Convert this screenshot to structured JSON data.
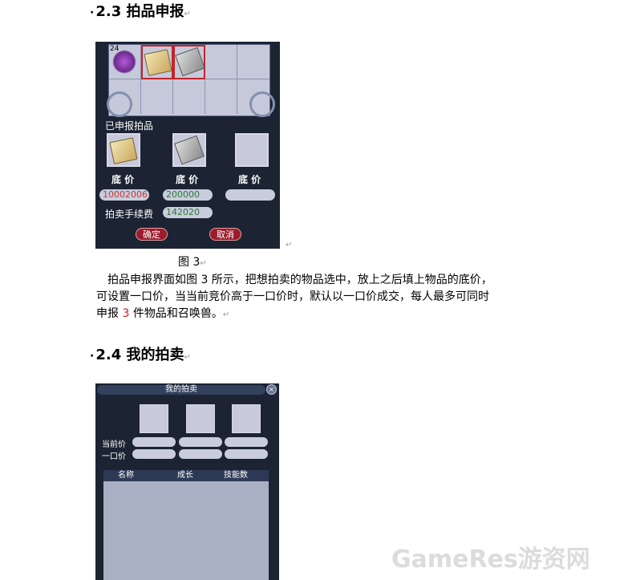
{
  "section1": {
    "bullet": "·",
    "title": "2.3 拍品申报",
    "mark": "↵"
  },
  "panel1": {
    "slot_count": "24",
    "reported_label": "已申报拍品",
    "floor_label": "底 价",
    "prices": [
      "10002006",
      "200000",
      ""
    ],
    "fee_label": "拍卖手续费",
    "fee_value": "142020",
    "ok": "确定",
    "cancel": "取消"
  },
  "figure_mark": "↵",
  "caption": {
    "text": "图 3",
    "mark": "↵"
  },
  "paragraph": {
    "line1": "拍品申报界面如图 3 所示，把想拍卖的物品选中，放上之后填上物品的底价，",
    "line2": "可设置一口价，当当前竞价高于一口价时，默认以一口价成交，每人最多可同时",
    "line3_before": "申报 ",
    "line3_red": "3",
    "line3_after": " 件物品和召唤兽。",
    "mark": "↵"
  },
  "section2": {
    "bullet": "·",
    "title": "2.4 我的拍卖",
    "mark": "↵"
  },
  "panel2": {
    "title": "我的拍卖",
    "close": "×",
    "current_price_label": "当前价",
    "buyout_label": "一口价",
    "columns": [
      "名称",
      "成长",
      "技能数"
    ]
  },
  "watermark": "GameRes游资网",
  "colors": {
    "panel_bg": "#1c2433",
    "slot_bg": "#c6c9da",
    "selected_border": "#c2242a",
    "red_price": "#c23a3a",
    "green_price": "#2e7a3a"
  }
}
